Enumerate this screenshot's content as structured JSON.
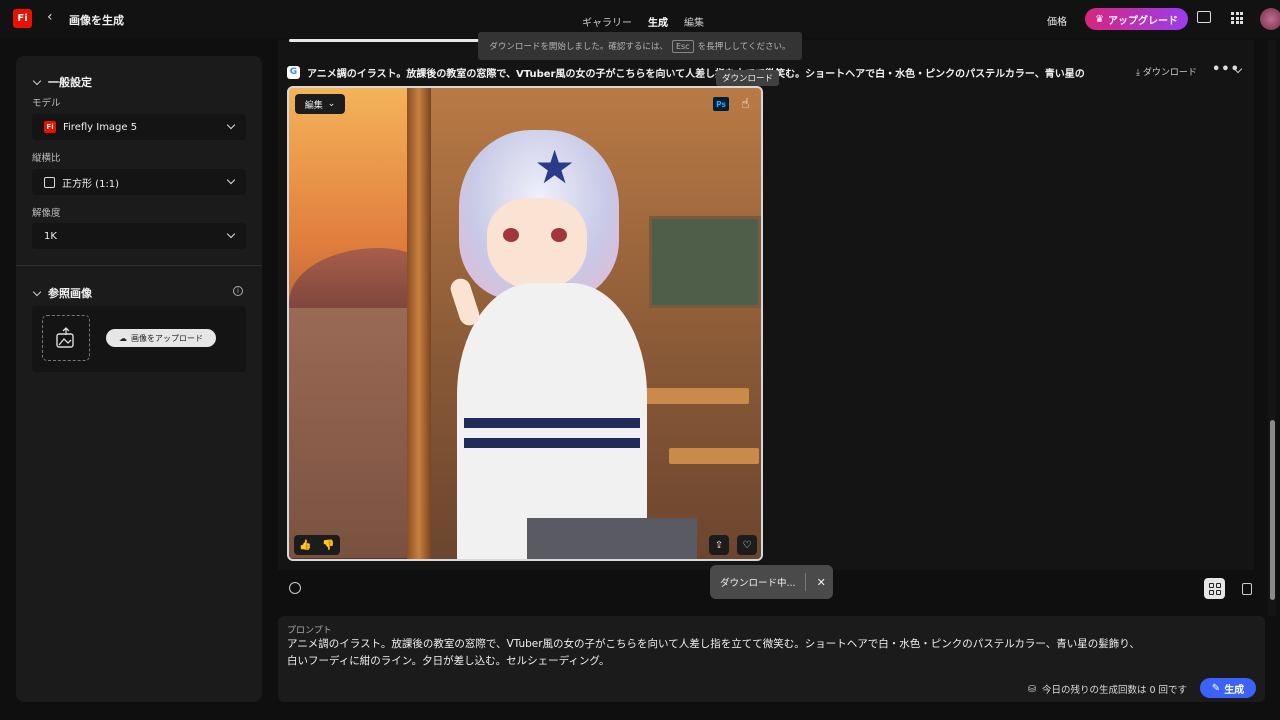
{
  "topbar": {
    "logo": "Fi",
    "back_icon": "‹",
    "title": "画像を生成",
    "nav": [
      "ギャラリー",
      "生成",
      "編集"
    ],
    "price": "価格",
    "upgrade": "アップグレード"
  },
  "sidebar": {
    "general_title": "一般設定",
    "model_label": "モデル",
    "model_value": "Firefly Image 5",
    "model_badge": "Fi",
    "ratio_label": "縦横比",
    "ratio_value": "正方形 (1:1)",
    "resolution_label": "解像度",
    "resolution_value": "1K",
    "reference_title": "参照画像",
    "upload_label": "画像をアップロード",
    "info": "i"
  },
  "toast_top": {
    "text_before": "ダウンロードを開始しました。確認するには、",
    "key": "Esc",
    "text_after": "を長押ししてください。"
  },
  "result": {
    "provider_icon": "G",
    "prompt": "アニメ調のイラスト。放課後の教室の窓際で、VTuber風の女の子がこちらを向いて人差し指を立てて微笑む。ショートヘアで白・水色・ピンクのパステルカラー、青い星の",
    "download_label": "⤓ ダウンロード",
    "tooltip": "ダウンロード",
    "edit_label": "編集",
    "ps_badge": "Ps"
  },
  "download_toast": {
    "text": "ダウンロード中...",
    "close": "✕"
  },
  "prompt_panel": {
    "label": "プロンプト",
    "text_line1": "アニメ調のイラスト。放課後の教室の窓際で、VTuber風の女の子がこちらを向いて人差し指を立てて微笑む。ショートヘアで白・水色・ピンクのパステルカラー、青い星の髪飾り、",
    "text_line2": "白いフーディに紺のライン。夕日が差し込む。セルシェーディング。",
    "remaining": "今日の残りの生成回数は 0 回です",
    "generate": "生成"
  },
  "colors": {
    "accent": "#3b63fb",
    "brand": "#eb1000",
    "upgrade_gradient": [
      "#d7257d",
      "#9b3df0"
    ]
  }
}
